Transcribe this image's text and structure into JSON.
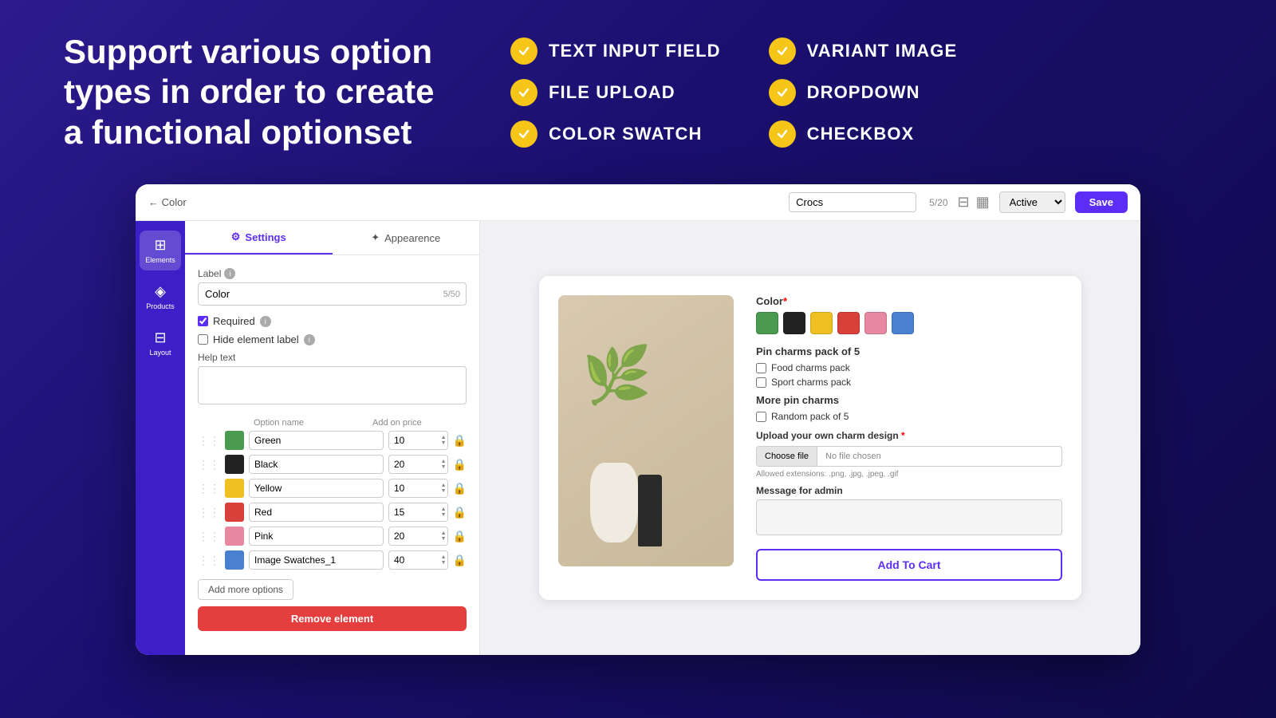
{
  "headline": "Support various option types in order to create a functional optionset",
  "features": [
    {
      "id": "text-input",
      "label": "TEXT INPUT FIELD"
    },
    {
      "id": "variant-image",
      "label": "VARIANT IMAGE"
    },
    {
      "id": "file-upload",
      "label": "FILE UPLOAD"
    },
    {
      "id": "dropdown",
      "label": "DROPDOWN"
    },
    {
      "id": "color-swatch",
      "label": "COLOR SWATCH"
    },
    {
      "id": "checkbox",
      "label": "CHECKBOX"
    }
  ],
  "topbar": {
    "back_label": "← Color",
    "product_name": "Crocs",
    "char_count": "5/20",
    "status": "Active",
    "save_label": "Save"
  },
  "sidebar": {
    "items": [
      {
        "id": "elements",
        "label": "Elements",
        "icon": "⊞"
      },
      {
        "id": "products",
        "label": "Products",
        "icon": "◈"
      },
      {
        "id": "layout",
        "label": "Layout",
        "icon": "⊟"
      }
    ]
  },
  "left_panel": {
    "tabs": [
      {
        "id": "settings",
        "label": "Settings",
        "icon": "⚙"
      },
      {
        "id": "appearance",
        "label": "Appearence",
        "icon": "✦"
      }
    ],
    "label_field": {
      "label": "Label",
      "value": "Color",
      "char_count": "5/50"
    },
    "required_label": "Required",
    "hide_label": "Hide element label",
    "help_text_label": "Help text",
    "help_text_placeholder": "",
    "options_header": {
      "col1": "Option name",
      "col2": "Add on price"
    },
    "options": [
      {
        "name": "Green",
        "price": "10",
        "color": "green"
      },
      {
        "name": "Black",
        "price": "20",
        "color": "black"
      },
      {
        "name": "Yellow",
        "price": "10",
        "color": "yellow"
      },
      {
        "name": "Red",
        "price": "15",
        "color": "red"
      },
      {
        "name": "Pink",
        "price": "20",
        "color": "pink"
      },
      {
        "name": "Image Swatches_1",
        "price": "40",
        "color": "blue"
      }
    ],
    "add_more_label": "Add more options",
    "remove_label": "Remove element"
  },
  "preview": {
    "color_label": "Color",
    "required_asterisk": "*",
    "swatches": [
      "green",
      "black",
      "yellow",
      "red",
      "pink",
      "blue"
    ],
    "pin_charms_title": "Pin charms pack of 5",
    "checkboxes": [
      "Food charms pack",
      "Sport charms pack"
    ],
    "more_pin_charms": "More pin charms",
    "random_pack": "Random pack of 5",
    "upload_label": "Upload your own charm design",
    "choose_file_btn": "Choose file",
    "no_file_text": "No file chosen",
    "allowed_ext": "Allowed extensions: .png, .jpg, .jpeg, .gif",
    "message_label": "Message for admin",
    "add_to_cart_label": "Add To Cart"
  }
}
